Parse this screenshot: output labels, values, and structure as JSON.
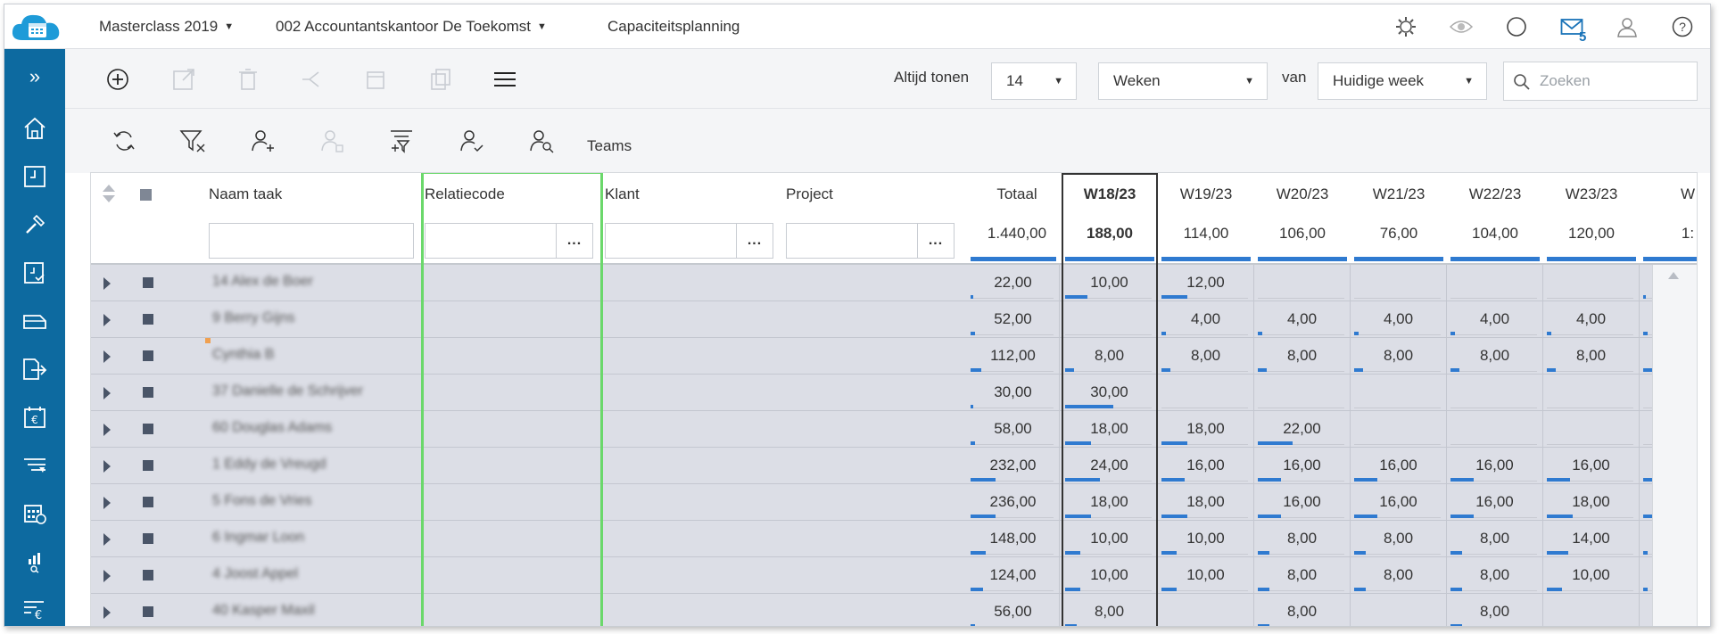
{
  "header": {
    "menu": [
      {
        "label": "Masterclass 2019",
        "dropdown": true
      },
      {
        "label": "002 Accountantskantoor De Toekomst",
        "dropdown": true
      },
      {
        "label": "Capaciteitsplanning",
        "dropdown": false
      }
    ],
    "icons": [
      "settings-icon",
      "eye-icon",
      "circle-icon",
      "mail-icon",
      "user-icon",
      "help-icon"
    ],
    "mail_count": "5"
  },
  "sidebar": {
    "items": [
      "expand-icon",
      "home-icon",
      "timesheet-icon",
      "tools-icon",
      "document-check-icon",
      "print-icon",
      "export-icon",
      "calendar-euro-icon",
      "filter-lines-icon",
      "calendar-grid-icon",
      "chart-search-icon",
      "list-euro-icon"
    ]
  },
  "toolbar": {
    "show_always_label": "Altijd tonen",
    "show_count": "14",
    "period_unit": "Weken",
    "from_label": "van",
    "from_value": "Huidige week",
    "search_placeholder": "Zoeken"
  },
  "toolbar2": {
    "teams_label": "Teams"
  },
  "grid": {
    "columns": {
      "name": "Naam taak",
      "relation": "Relatiecode",
      "client": "Klant",
      "project": "Project",
      "total": "Totaal",
      "filter_button": "..."
    },
    "total_sum": "1.440,00",
    "weeks": [
      {
        "label": "W18/23",
        "total": "188,00",
        "current": true
      },
      {
        "label": "W19/23",
        "total": "114,00",
        "current": false
      },
      {
        "label": "W20/23",
        "total": "106,00",
        "current": false
      },
      {
        "label": "W21/23",
        "total": "76,00",
        "current": false
      },
      {
        "label": "W22/23",
        "total": "104,00",
        "current": false
      },
      {
        "label": "W23/23",
        "total": "120,00",
        "current": false
      },
      {
        "label": "W",
        "total": "1:",
        "current": false
      }
    ],
    "rows": [
      {
        "name": "14 Alex de Boer",
        "total": "22,00",
        "total_fill": 0.02,
        "weeks": [
          "10,00",
          "12,00",
          "",
          "",
          "",
          "",
          ""
        ],
        "fills": [
          0.25,
          0.3,
          0,
          0,
          0,
          0,
          0.02
        ]
      },
      {
        "name": "9 Berry Gijns",
        "total": "52,00",
        "total_fill": 0.05,
        "weeks": [
          "",
          "4,00",
          "4,00",
          "4,00",
          "4,00",
          "4,00",
          ""
        ],
        "fills": [
          0,
          0.05,
          0.05,
          0.05,
          0.05,
          0.05,
          0.05
        ]
      },
      {
        "name": "Cynthia B",
        "total": "112,00",
        "total_fill": 0.13,
        "weeks": [
          "8,00",
          "8,00",
          "8,00",
          "8,00",
          "8,00",
          "8,00",
          ""
        ],
        "fills": [
          0.1,
          0.1,
          0.1,
          0.1,
          0.1,
          0.1,
          0.1
        ]
      },
      {
        "name": "37 Danielle de Schrijver",
        "total": "30,00",
        "total_fill": 0.02,
        "weeks": [
          "30,00",
          "",
          "",
          "",
          "",
          "",
          ""
        ],
        "fills": [
          0.55,
          0,
          0,
          0,
          0,
          0,
          0
        ]
      },
      {
        "name": "60 Douglas Adams",
        "total": "58,00",
        "total_fill": 0.05,
        "weeks": [
          "18,00",
          "18,00",
          "22,00",
          "",
          "",
          "",
          ""
        ],
        "fills": [
          0.3,
          0.3,
          0.4,
          0,
          0,
          0,
          0
        ]
      },
      {
        "name": "1 Eddy de Vreugd",
        "total": "232,00",
        "total_fill": 0.3,
        "weeks": [
          "24,00",
          "16,00",
          "16,00",
          "16,00",
          "16,00",
          "16,00",
          ""
        ],
        "fills": [
          0.4,
          0.27,
          0.27,
          0.27,
          0.27,
          0.27,
          0.1
        ]
      },
      {
        "name": "5 Fons de Vries",
        "total": "236,00",
        "total_fill": 0.3,
        "weeks": [
          "18,00",
          "18,00",
          "16,00",
          "16,00",
          "16,00",
          "18,00",
          ""
        ],
        "fills": [
          0.3,
          0.3,
          0.27,
          0.27,
          0.27,
          0.3,
          0.1
        ]
      },
      {
        "name": "6 Ingmar Loon",
        "total": "148,00",
        "total_fill": 0.18,
        "weeks": [
          "10,00",
          "10,00",
          "8,00",
          "8,00",
          "8,00",
          "14,00",
          ""
        ],
        "fills": [
          0.17,
          0.17,
          0.13,
          0.13,
          0.13,
          0.24,
          0.05
        ]
      },
      {
        "name": "4 Joost Appel",
        "total": "124,00",
        "total_fill": 0.15,
        "weeks": [
          "10,00",
          "10,00",
          "8,00",
          "8,00",
          "8,00",
          "10,00",
          ""
        ],
        "fills": [
          0.17,
          0.17,
          0.13,
          0.13,
          0.13,
          0.17,
          0.05
        ]
      },
      {
        "name": "40 Kasper Maxil",
        "total": "56,00",
        "total_fill": 0.05,
        "weeks": [
          "8,00",
          "",
          "8,00",
          "",
          "8,00",
          "",
          ""
        ],
        "fills": [
          0.13,
          0,
          0.13,
          0,
          0.13,
          0,
          0
        ]
      }
    ]
  },
  "colors": {
    "sidebar": "#0d6aa0",
    "accent": "#2f7ad0",
    "selection_outline": "#6bd86b",
    "row_bg": "#dcdee6"
  }
}
